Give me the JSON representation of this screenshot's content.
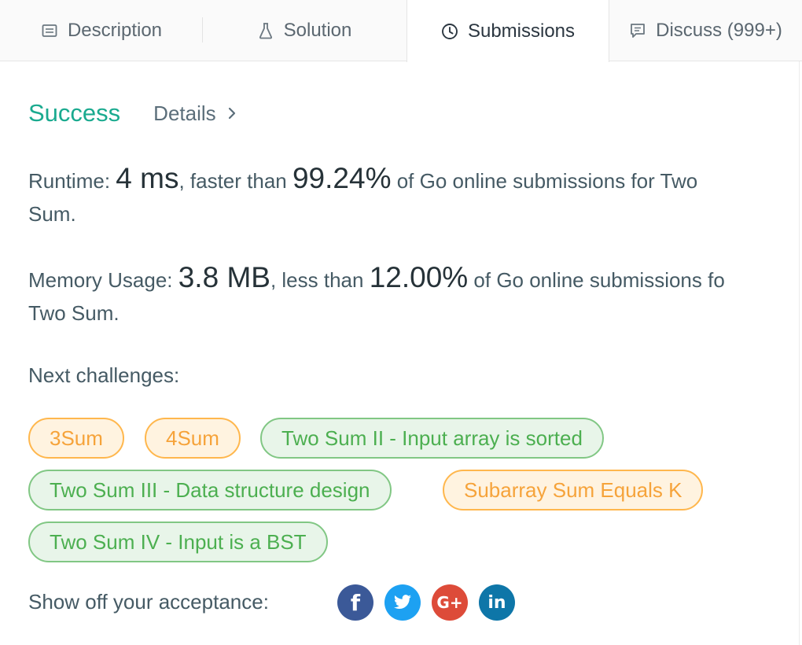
{
  "tabs": [
    {
      "label": "Description",
      "icon": "description-icon"
    },
    {
      "label": "Solution",
      "icon": "flask-icon"
    },
    {
      "label": "Submissions",
      "icon": "clock-icon"
    },
    {
      "label": "Discuss (999+)",
      "icon": "comment-icon"
    }
  ],
  "active_tab": "Submissions",
  "result": {
    "status": "Success",
    "details_label": "Details"
  },
  "runtime": {
    "label": "Runtime: ",
    "value": "4 ms",
    "mid": ", faster than ",
    "percent": "99.24%",
    "tail_line1": " of Go online submissions for Two",
    "tail_line2": "Sum."
  },
  "memory": {
    "label": "Memory Usage: ",
    "value": "3.8 MB",
    "mid": ", less than ",
    "percent": "12.00%",
    "tail_line1": " of Go online submissions fo",
    "tail_line2": "Two Sum."
  },
  "next": {
    "label": "Next challenges:",
    "challenges": [
      {
        "title": "3Sum",
        "difficulty": "medium"
      },
      {
        "title": "4Sum",
        "difficulty": "medium"
      },
      {
        "title": "Two Sum II - Input array is sorted",
        "difficulty": "easy"
      },
      {
        "title": "Two Sum III - Data structure design",
        "difficulty": "easy"
      },
      {
        "title": "Subarray Sum Equals K",
        "difficulty": "medium"
      },
      {
        "title": "Two Sum IV - Input is a BST",
        "difficulty": "easy"
      }
    ]
  },
  "share": {
    "label": "Show off your acceptance:",
    "networks": [
      {
        "name": "facebook",
        "glyph": "f",
        "color": "#3b5998"
      },
      {
        "name": "twitter",
        "glyph": "",
        "color": "#1da1f2"
      },
      {
        "name": "google-plus",
        "glyph": "G+",
        "color": "#dd4b39"
      },
      {
        "name": "linkedin",
        "glyph": "in",
        "color": "#0e76a8"
      }
    ]
  },
  "colors": {
    "success": "#1aaa8f",
    "medium_bg": "#fff3e0",
    "medium_border": "#ffb74d",
    "easy_bg": "#e8f5e9",
    "easy_border": "#81c784"
  }
}
